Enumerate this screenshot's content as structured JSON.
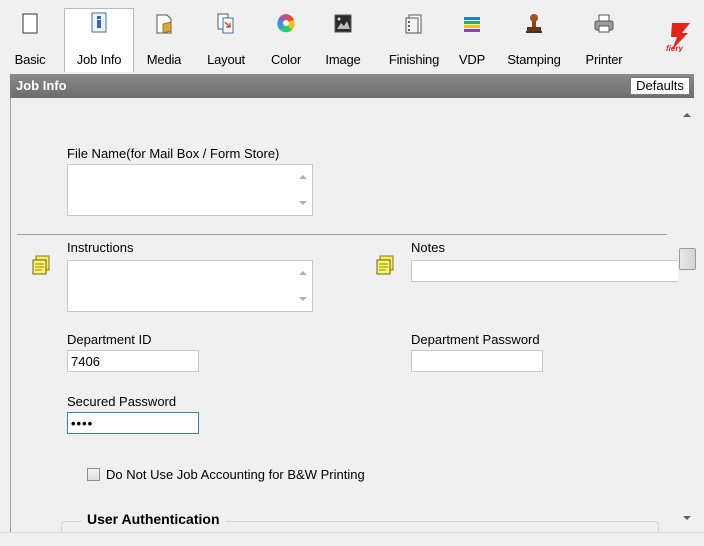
{
  "toolbar": {
    "tabs": [
      {
        "label": "Basic",
        "icon": "blank-page-icon"
      },
      {
        "label": "Job Info",
        "icon": "job-info-icon"
      },
      {
        "label": "Media",
        "icon": "media-icon"
      },
      {
        "label": "Layout",
        "icon": "layout-icon"
      },
      {
        "label": "Color",
        "icon": "color-wheel-icon"
      },
      {
        "label": "Image",
        "icon": "image-icon"
      },
      {
        "label": "Finishing",
        "icon": "finishing-icon"
      },
      {
        "label": "VDP",
        "icon": "vdp-icon"
      },
      {
        "label": "Stamping",
        "icon": "stamp-icon"
      },
      {
        "label": "Printer",
        "icon": "printer-icon"
      }
    ],
    "active_tab": "Job Info",
    "logo": "fiery",
    "logo_color": "#e0251b"
  },
  "section": {
    "title": "Job Info",
    "defaults_label": "Defaults"
  },
  "form": {
    "file_name_label": "File Name(for Mail Box / Form Store)",
    "file_name_value": "",
    "instructions_label": "Instructions",
    "instructions_value": "",
    "notes_label": "Notes",
    "notes_value": "",
    "department_id_label": "Department ID",
    "department_id_value": "7406",
    "department_password_label": "Department Password",
    "department_password_value": "",
    "secured_password_label": "Secured Password",
    "secured_password_value": "••••",
    "job_accounting_label": "Do Not Use Job Accounting for B&W Printing",
    "job_accounting_checked": false,
    "user_auth_label": "User Authentication"
  }
}
